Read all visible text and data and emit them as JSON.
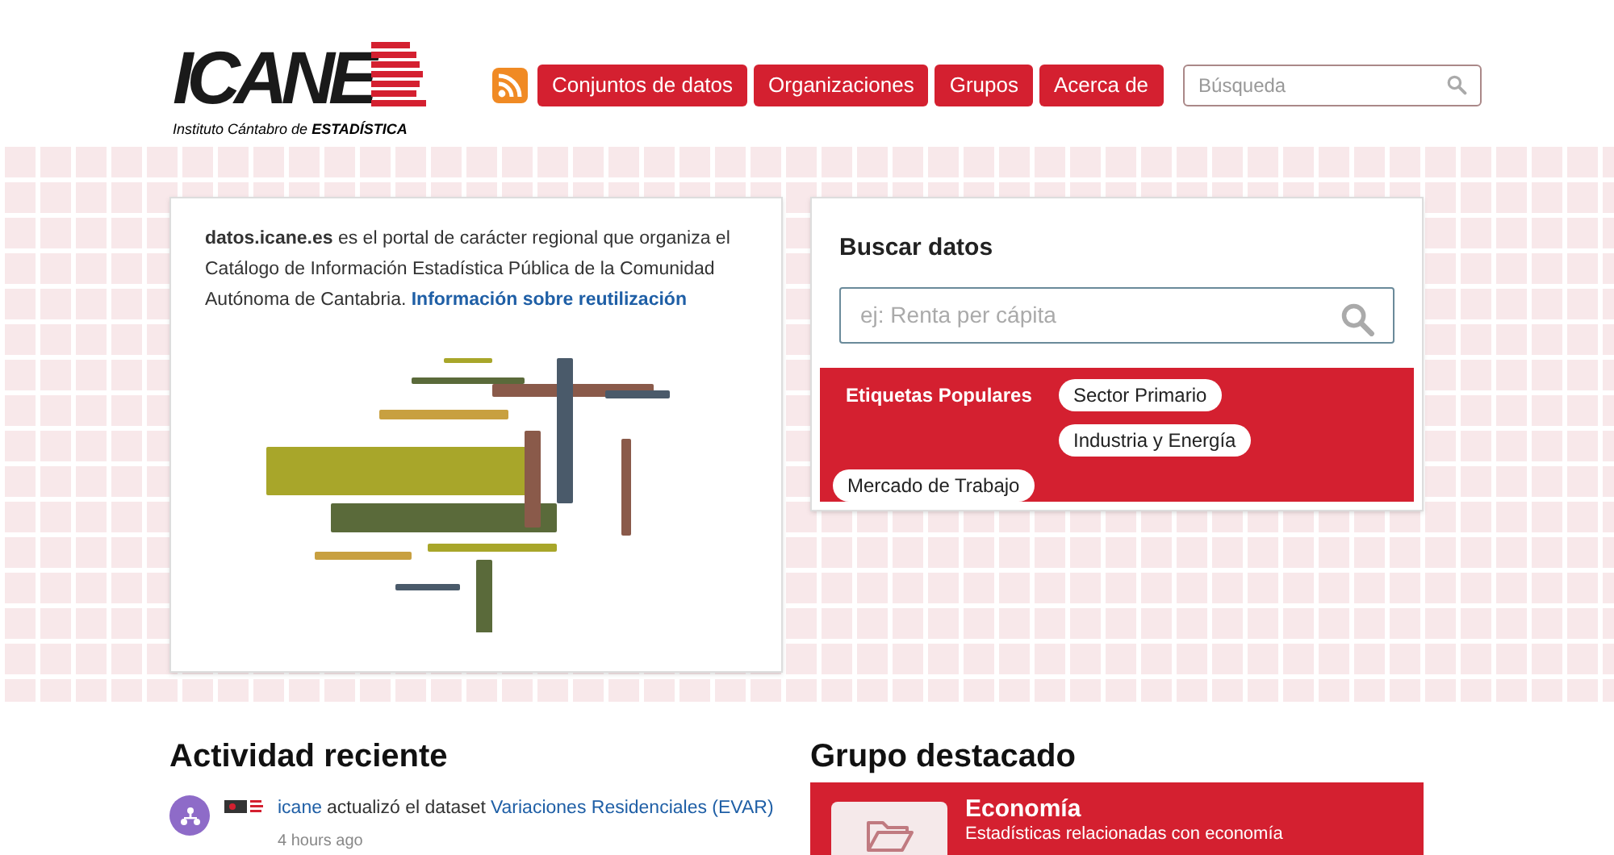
{
  "logo": {
    "wordmark": "ICANE",
    "tagline_prefix": "Instituto Cántabro de",
    "tagline_bold": "ESTADÍSTICA"
  },
  "nav": [
    {
      "label": "Conjuntos de datos"
    },
    {
      "label": "Organizaciones"
    },
    {
      "label": "Grupos"
    },
    {
      "label": "Acerca de"
    }
  ],
  "header_search": {
    "placeholder": "Búsqueda"
  },
  "intro": {
    "text": "**datos.icane.es** es el portal de carácter regional que organiza el Catálogo de Información Estadística Pública de la Comunidad Autónoma de Cantabria.",
    "link": "Información sobre reutilización"
  },
  "search_panel": {
    "title": "Buscar datos",
    "placeholder": "ej: Renta per cápita",
    "tags_label": "Etiquetas Populares",
    "tags": [
      "Sector Primario",
      "Industria y Energía",
      "Mercado de Trabajo"
    ]
  },
  "activity": {
    "title": "Actividad reciente",
    "items": [
      {
        "user": "icane",
        "action": "actualizó el dataset",
        "target": "Variaciones Residenciales (EVAR)",
        "time": "4 hours ago"
      }
    ]
  },
  "featured_group": {
    "title": "Grupo destacado",
    "name": "Economía",
    "description": "Estadísticas relacionadas con economía"
  }
}
